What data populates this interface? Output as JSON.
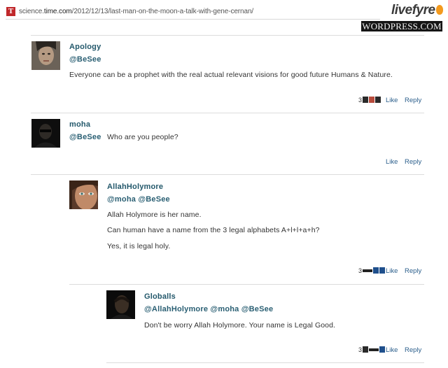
{
  "browser": {
    "favicon_letter": "T",
    "url_prefix": "science.",
    "url_domain": "time.com",
    "url_path": "/2012/12/13/last-man-on-the-moon-a-talk-with-gene-cernan/"
  },
  "branding": {
    "livefyre_label": "livefyre",
    "wordpress_label": "WORDPRESS.COM"
  },
  "comments": [
    {
      "author": "Apology",
      "mention": "@BeSee",
      "lines": [
        "Everyone can be a prophet with the real actual relevant visions for good future Humans & Nature."
      ],
      "like_count": "3",
      "like_label": "Like",
      "reply_label": "Reply"
    },
    {
      "author": "moha",
      "mention": "@BeSee",
      "lines": [
        "Who are you people?"
      ],
      "like_count": "",
      "like_label": "Like",
      "reply_label": "Reply"
    },
    {
      "author": "AllahHolymore",
      "mention": "@moha @BeSee",
      "lines": [
        "Allah Holymore is her name.",
        "Can human have a name from the 3 legal alphabets A+l+l+a+h?",
        "Yes, it is legal holy."
      ],
      "like_count": "3",
      "like_label": "Like",
      "reply_label": "Reply"
    },
    {
      "author": "Globalls",
      "mention": "@AllahHolymore @moha @BeSee",
      "lines": [
        "Don't be worry Allah Holymore. Your name is Legal Good."
      ],
      "like_count": "3",
      "like_label": "Like",
      "reply_label": "Reply"
    }
  ],
  "colors": {
    "author": "#23586b",
    "link": "#2c5f8c",
    "separator": "#dcdcdc"
  }
}
